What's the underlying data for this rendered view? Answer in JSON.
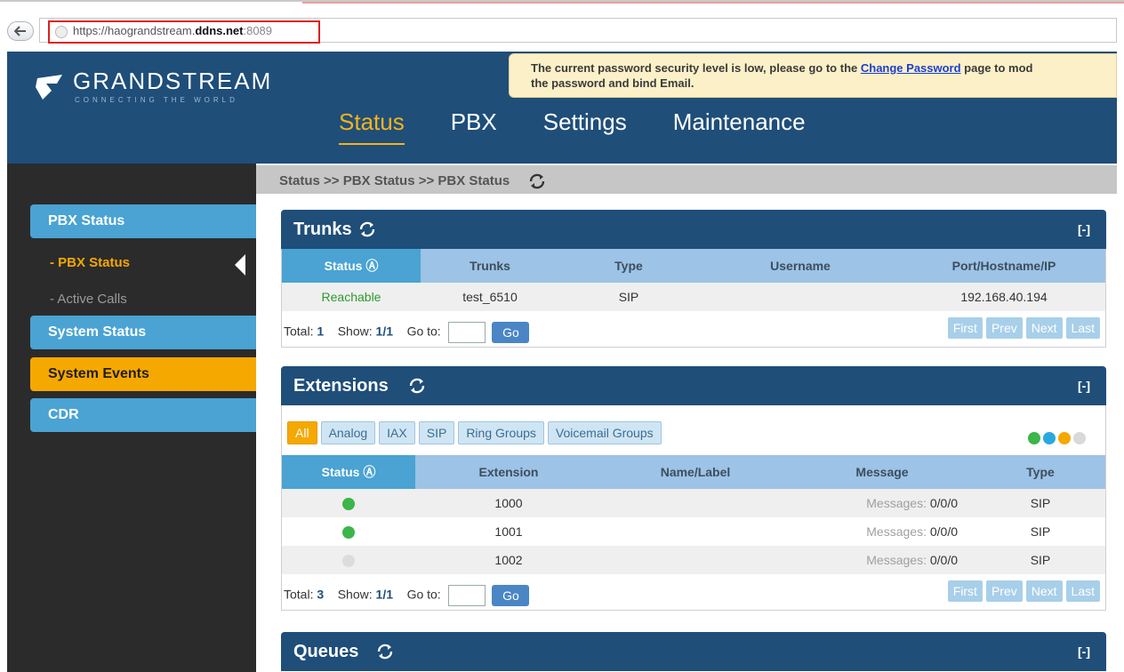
{
  "browser": {
    "url_prefix": "https://haograndstream.",
    "url_domain": "ddns.net",
    "url_port": ":8089"
  },
  "header": {
    "logo_name": "GRANDSTREAM",
    "logo_tagline": "CONNECTING THE WORLD",
    "notice_before": "The current password security level is low, please go to the ",
    "notice_link": "Change Password",
    "notice_after_line1": " page to mod",
    "notice_line2": "the password and bind Email.",
    "nav": [
      "Status",
      "PBX",
      "Settings",
      "Maintenance"
    ]
  },
  "sidebar": {
    "groups": [
      "PBX Status",
      "System Status",
      "System Events",
      "CDR"
    ],
    "subitems": [
      "- PBX Status",
      "- Active Calls"
    ]
  },
  "breadcrumb": "Status >> PBX Status >> PBX Status",
  "trunks": {
    "title": "Trunks",
    "collapse": "[-]",
    "columns": [
      "Status",
      "Trunks",
      "Type",
      "Username",
      "Port/Hostname/IP"
    ],
    "rows": [
      {
        "status": "Reachable",
        "trunk": "test_6510",
        "type": "SIP",
        "username": "",
        "host": "192.168.40.194"
      }
    ],
    "pager": {
      "total_label": "Total:",
      "total": "1",
      "show_label": "Show:",
      "show": "1/1",
      "goto_label": "Go to:",
      "go": "Go"
    }
  },
  "extensions": {
    "title": "Extensions",
    "collapse": "[-]",
    "filters": [
      "All",
      "Analog",
      "IAX",
      "SIP",
      "Ring Groups",
      "Voicemail Groups"
    ],
    "legend_colors": [
      "#3cb54a",
      "#29a8e0",
      "#f5a800",
      "#d9d9d9"
    ],
    "columns": [
      "Status",
      "Extension",
      "Name/Label",
      "Message",
      "Type"
    ],
    "rows": [
      {
        "status_color": "#3cb54a",
        "extension": "1000",
        "name": "",
        "msg_label": "Messages:",
        "msg_value": "0/0/0",
        "type": "SIP"
      },
      {
        "status_color": "#3cb54a",
        "extension": "1001",
        "name": "",
        "msg_label": "Messages:",
        "msg_value": "0/0/0",
        "type": "SIP"
      },
      {
        "status_color": "#dcdcdc",
        "extension": "1002",
        "name": "",
        "msg_label": "Messages:",
        "msg_value": "0/0/0",
        "type": "SIP"
      }
    ],
    "pager": {
      "total_label": "Total:",
      "total": "3",
      "show_label": "Show:",
      "show": "1/1",
      "goto_label": "Go to:",
      "go": "Go"
    }
  },
  "pager_buttons": [
    "First",
    "Prev",
    "Next",
    "Last"
  ],
  "queues": {
    "title": "Queues",
    "collapse": "[-]"
  }
}
